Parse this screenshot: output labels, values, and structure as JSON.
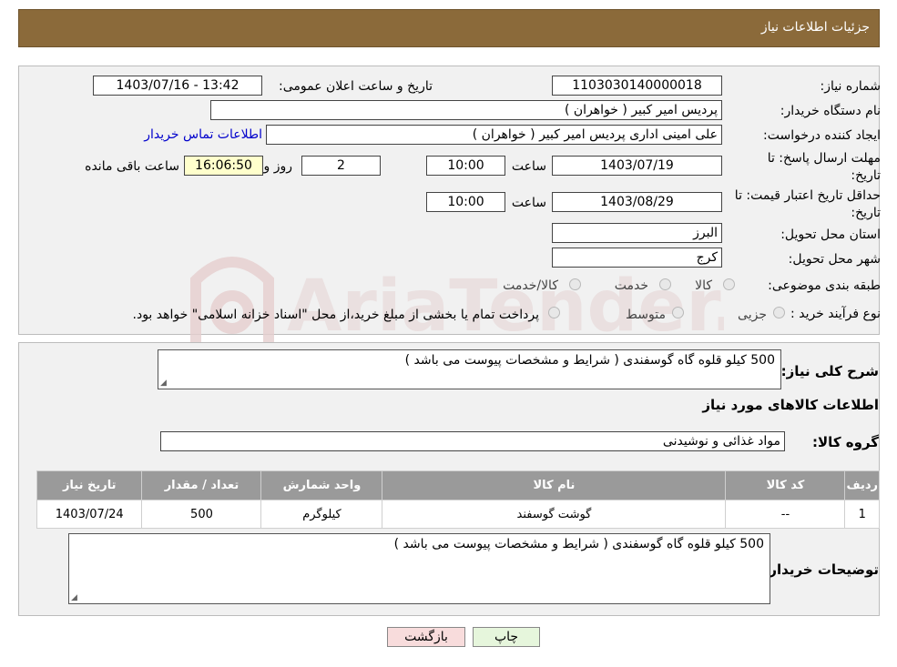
{
  "header": {
    "title": "جزئیات اطلاعات نیاز"
  },
  "form": {
    "need_number_label": "شماره نیاز:",
    "need_number": "1103030140000018",
    "announce_label": "تاریخ و ساعت اعلان عمومی:",
    "announce_value": "1403/07/16 - 13:42",
    "buyer_label": "نام دستگاه خریدار:",
    "buyer_value": "پردیس امیر کبیر ( خواهران )",
    "creator_label": "ایجاد کننده درخواست:",
    "creator_value": "علی امینی اداری پردیس امیر کبیر ( خواهران )",
    "contact_link": "اطلاعات تماس خریدار",
    "reply_label": "مهلت ارسال پاسخ: تا تاریخ:",
    "reply_date": "1403/07/19",
    "time_label": "ساعت",
    "reply_time": "10:00",
    "days_value": "2",
    "days_label": "روز و",
    "remaining_value": "16:06:50",
    "remaining_label": "ساعت باقی مانده",
    "validity_label": "حداقل تاریخ اعتبار قیمت: تا تاریخ:",
    "validity_date": "1403/08/29",
    "validity_time": "10:00",
    "province_label": "استان محل تحویل:",
    "province_value": "البرز",
    "city_label": "شهر محل تحویل:",
    "city_value": "کرج",
    "category_label": "طبقه بندی موضوعی:",
    "category_options": [
      "کالا",
      "خدمت",
      "کالا/خدمت"
    ],
    "process_label": "نوع فرآیند خرید :",
    "process_options": [
      "جزیی",
      "متوسط"
    ],
    "process_note": "پرداخت تمام یا بخشی از مبلغ خرید،از محل \"اسناد خزانه اسلامی\" خواهد بود."
  },
  "details": {
    "summary_label": "شرح کلی نیاز:",
    "summary_value": "500 کیلو قلوه گاه گوسفندی ( شرایط و مشخصات پیوست می باشد )",
    "goods_heading": "اطلاعات کالاهای مورد نیاز",
    "group_label": "گروه کالا:",
    "group_value": "مواد غذائی و نوشیدنی",
    "table": {
      "headers": [
        "ردیف",
        "کد کالا",
        "نام کالا",
        "واحد شمارش",
        "تعداد / مقدار",
        "تاریخ نیاز"
      ],
      "rows": [
        [
          "1",
          "--",
          "گوشت گوسفند",
          "کیلوگرم",
          "500",
          "1403/07/24"
        ]
      ]
    },
    "buyer_notes_label": "توضیحات خریدار:",
    "buyer_notes_value": "500 کیلو قلوه گاه گوسفندی ( شرایط و مشخصات پیوست می باشد )"
  },
  "buttons": {
    "print": "چاپ",
    "back": "بازگشت"
  },
  "watermark": {
    "text": "AriaTender.neT"
  },
  "colors": {
    "header": "#8b6a3a",
    "table_header": "#9a9a9a",
    "back_button": "#f8dcdc",
    "print_button": "#e6f6dc"
  }
}
